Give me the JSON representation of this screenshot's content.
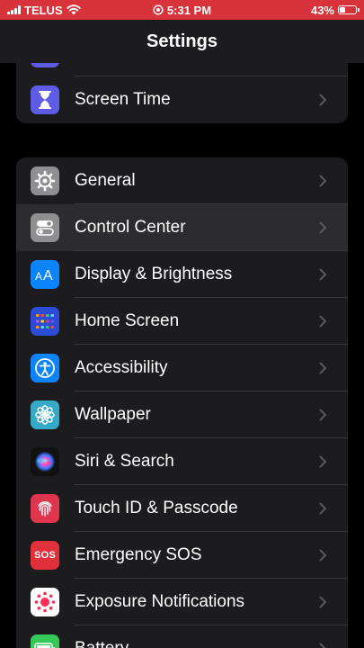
{
  "status_bar": {
    "carrier": "TELUS",
    "time": "5:31 PM",
    "battery_percent": "43%",
    "battery_level": 0.43,
    "bar_color": "#d8323a"
  },
  "header": {
    "title": "Settings"
  },
  "group1": {
    "items": [
      {
        "label": "Screen Time",
        "icon": "hourglass-icon",
        "color": "#5e5ce6"
      }
    ]
  },
  "group2": {
    "items": [
      {
        "label": "General",
        "icon": "gear-icon",
        "color": "#8e8e93"
      },
      {
        "label": "Control Center",
        "icon": "toggles-icon",
        "color": "#8e8e93",
        "highlighted": true
      },
      {
        "label": "Display & Brightness",
        "icon": "text-size-icon",
        "color": "#0a84ff"
      },
      {
        "label": "Home Screen",
        "icon": "app-grid-icon",
        "color": "#2c4bd6"
      },
      {
        "label": "Accessibility",
        "icon": "accessibility-icon",
        "color": "#0a84ff"
      },
      {
        "label": "Wallpaper",
        "icon": "flower-icon",
        "color": "#35aac8"
      },
      {
        "label": "Siri & Search",
        "icon": "siri-icon",
        "color": "#111111"
      },
      {
        "label": "Touch ID & Passcode",
        "icon": "fingerprint-icon",
        "color": "#e0354f"
      },
      {
        "label": "Emergency SOS",
        "icon": "sos-icon",
        "color": "#e0303a",
        "icon_text": "SOS"
      },
      {
        "label": "Exposure Notifications",
        "icon": "exposure-icon",
        "color": "#ffffff"
      },
      {
        "label": "Battery",
        "icon": "battery-icon",
        "color": "#34c759"
      }
    ]
  }
}
